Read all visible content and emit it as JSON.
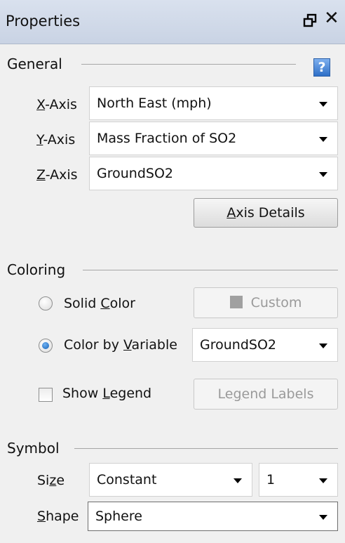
{
  "window": {
    "title": "Properties",
    "float_icon": "float-window-icon",
    "close_glyph": "✕"
  },
  "general": {
    "title": "General",
    "help_glyph": "?",
    "x_axis": {
      "prefix": "",
      "mnemonic": "X",
      "rest": "-Axis",
      "value": "North East (mph)"
    },
    "y_axis": {
      "prefix": "",
      "mnemonic": "Y",
      "rest": "-Axis",
      "value": "Mass Fraction of SO2"
    },
    "z_axis": {
      "prefix": "",
      "mnemonic": "Z",
      "rest": "-Axis",
      "value": "GroundSO2"
    },
    "axis_details": {
      "prefix": "",
      "mnemonic": "A",
      "rest": "xis Details"
    }
  },
  "coloring": {
    "title": "Coloring",
    "solid": {
      "prefix": "Solid ",
      "mnemonic": "C",
      "rest": "olor",
      "checked": false
    },
    "custom_button": "Custom",
    "custom_swatch_color": "#a0a0a0",
    "by_variable": {
      "prefix": "Color by ",
      "mnemonic": "V",
      "rest": "ariable",
      "checked": true
    },
    "variable_value": "GroundSO2",
    "show_legend": {
      "prefix": "Show ",
      "mnemonic": "L",
      "rest": "egend",
      "checked": false
    },
    "legend_labels": {
      "prefix": "Le",
      "mnemonic": "g",
      "rest": "end Labels"
    }
  },
  "symbol": {
    "title": "Symbol",
    "size": {
      "prefix": "Si",
      "mnemonic": "z",
      "rest": "e",
      "mode": "Constant",
      "value": "1"
    },
    "shape": {
      "prefix": "",
      "mnemonic": "S",
      "rest": "hape",
      "value": "Sphere"
    }
  }
}
